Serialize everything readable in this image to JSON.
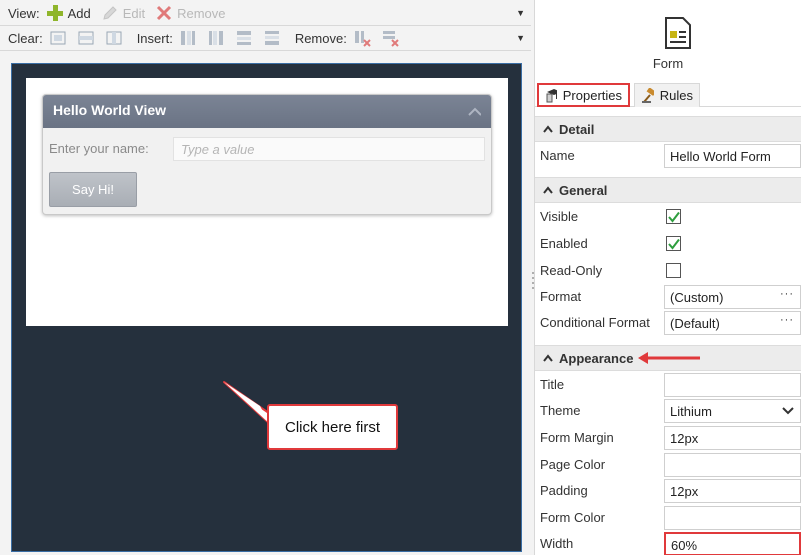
{
  "toolbar": {
    "view_label": "View:",
    "add_label": "Add",
    "edit_label": "Edit",
    "remove_label": "Remove",
    "clear_label": "Clear:",
    "insert_label": "Insert:",
    "remove2_label": "Remove:"
  },
  "view": {
    "title": "Hello World View",
    "name_label": "Enter your name:",
    "name_placeholder": "Type a value",
    "button_label": "Say Hi!"
  },
  "callout": {
    "text": "Click here first"
  },
  "panel": {
    "object_label": "Form",
    "tabs": {
      "properties": "Properties",
      "rules": "Rules"
    },
    "sections": {
      "detail": "Detail",
      "general": "General",
      "appearance": "Appearance"
    },
    "props": {
      "name_label": "Name",
      "name_value": "Hello World Form",
      "visible_label": "Visible",
      "visible_checked": true,
      "enabled_label": "Enabled",
      "enabled_checked": true,
      "readonly_label": "Read-Only",
      "readonly_checked": false,
      "format_label": "Format",
      "format_value": "(Custom)",
      "condformat_label": "Conditional Format",
      "condformat_value": "(Default)",
      "title_label": "Title",
      "title_value": "",
      "theme_label": "Theme",
      "theme_value": "Lithium",
      "formmargin_label": "Form Margin",
      "formmargin_value": "12px",
      "pagecolor_label": "Page Color",
      "pagecolor_value": "",
      "padding_label": "Padding",
      "padding_value": "12px",
      "formcolor_label": "Form Color",
      "formcolor_value": "",
      "width_label": "Width",
      "width_value": "60%"
    },
    "ellipsis": "···"
  },
  "colors": {
    "canvas_bg": "#25303d",
    "view_header": "#6f7889",
    "highlight_red": "#e0393b",
    "check_green": "#2e9e3e"
  }
}
